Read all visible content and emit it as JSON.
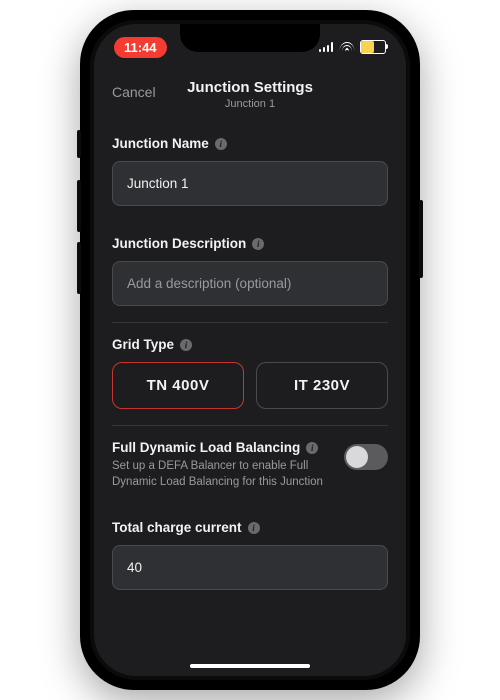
{
  "status": {
    "time": "11:44"
  },
  "nav": {
    "cancel": "Cancel",
    "title": "Junction Settings",
    "subtitle": "Junction 1"
  },
  "name_section": {
    "label": "Junction Name",
    "value": "Junction 1"
  },
  "desc_section": {
    "label": "Junction Description",
    "placeholder": "Add a description (optional)"
  },
  "grid_section": {
    "label": "Grid Type",
    "options": [
      "TN 400V",
      "IT 230V"
    ],
    "selected_index": 0
  },
  "dlb_section": {
    "label": "Full Dynamic Load Balancing",
    "desc": "Set up a DEFA Balancer to enable Full Dynamic Load Balancing for this Junction",
    "enabled": false
  },
  "current_section": {
    "label": "Total charge current",
    "value": "40"
  }
}
